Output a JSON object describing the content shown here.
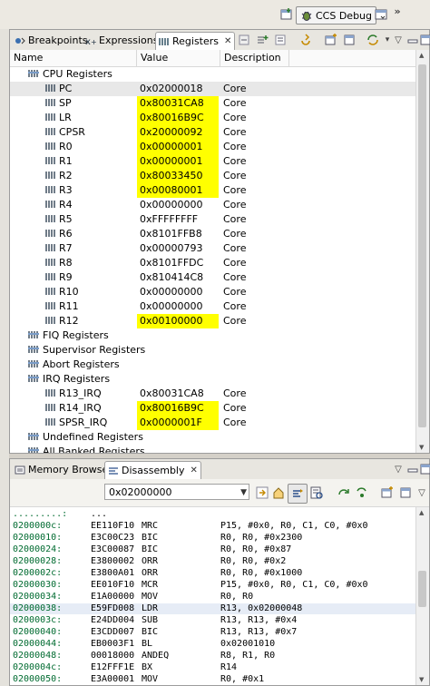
{
  "toolbar": {
    "perspective_label": "CCS Debug",
    "overflow_label": "»"
  },
  "registers_view": {
    "tabs": [
      {
        "label": "Breakpoints",
        "active": false
      },
      {
        "label": "Expressions",
        "active": false
      },
      {
        "label": "Registers",
        "active": true
      }
    ],
    "close_label": "✕",
    "columns": [
      "Name",
      "Value",
      "Description"
    ],
    "rows": [
      {
        "name": "CPU Registers",
        "value": "",
        "description": "",
        "group": true,
        "highlight": false
      },
      {
        "name": "PC",
        "value": "0x02000018",
        "description": "Core",
        "group": false,
        "highlight": false,
        "selected": true
      },
      {
        "name": "SP",
        "value": "0x80031CA8",
        "description": "Core",
        "group": false,
        "highlight": true
      },
      {
        "name": "LR",
        "value": "0x80016B9C",
        "description": "Core",
        "group": false,
        "highlight": true
      },
      {
        "name": "CPSR",
        "value": "0x20000092",
        "description": "Core",
        "group": false,
        "highlight": true
      },
      {
        "name": "R0",
        "value": "0x00000001",
        "description": "Core",
        "group": false,
        "highlight": true
      },
      {
        "name": "R1",
        "value": "0x00000001",
        "description": "Core",
        "group": false,
        "highlight": true
      },
      {
        "name": "R2",
        "value": "0x80033450",
        "description": "Core",
        "group": false,
        "highlight": true
      },
      {
        "name": "R3",
        "value": "0x00080001",
        "description": "Core",
        "group": false,
        "highlight": true
      },
      {
        "name": "R4",
        "value": "0x00000000",
        "description": "Core",
        "group": false,
        "highlight": false
      },
      {
        "name": "R5",
        "value": "0xFFFFFFFF",
        "description": "Core",
        "group": false,
        "highlight": false
      },
      {
        "name": "R6",
        "value": "0x8101FFB8",
        "description": "Core",
        "group": false,
        "highlight": false
      },
      {
        "name": "R7",
        "value": "0x00000793",
        "description": "Core",
        "group": false,
        "highlight": false
      },
      {
        "name": "R8",
        "value": "0x8101FFDC",
        "description": "Core",
        "group": false,
        "highlight": false
      },
      {
        "name": "R9",
        "value": "0x810414C8",
        "description": "Core",
        "group": false,
        "highlight": false
      },
      {
        "name": "R10",
        "value": "0x00000000",
        "description": "Core",
        "group": false,
        "highlight": false
      },
      {
        "name": "R11",
        "value": "0x00000000",
        "description": "Core",
        "group": false,
        "highlight": false
      },
      {
        "name": "R12",
        "value": "0x00100000",
        "description": "Core",
        "group": false,
        "highlight": true
      },
      {
        "name": "FIQ Registers",
        "value": "",
        "description": "",
        "group": true,
        "highlight": false
      },
      {
        "name": "Supervisor Registers",
        "value": "",
        "description": "",
        "group": true,
        "highlight": false
      },
      {
        "name": "Abort Registers",
        "value": "",
        "description": "",
        "group": true,
        "highlight": false
      },
      {
        "name": "IRQ Registers",
        "value": "",
        "description": "",
        "group": true,
        "highlight": false
      },
      {
        "name": "R13_IRQ",
        "value": "0x80031CA8",
        "description": "Core",
        "group": false,
        "highlight": false
      },
      {
        "name": "R14_IRQ",
        "value": "0x80016B9C",
        "description": "Core",
        "group": false,
        "highlight": true
      },
      {
        "name": "SPSR_IRQ",
        "value": "0x0000001F",
        "description": "Core",
        "group": false,
        "highlight": true
      },
      {
        "name": "Undefined Registers",
        "value": "",
        "description": "",
        "group": true,
        "highlight": false
      },
      {
        "name": "All Banked Registers",
        "value": "",
        "description": "",
        "group": true,
        "highlight": false
      }
    ]
  },
  "bottom_view": {
    "tabs": [
      {
        "label": "Memory Browser",
        "active": false
      },
      {
        "label": "Disassembly",
        "active": true
      }
    ],
    "close_label": "✕",
    "address_value": "0x02000000",
    "lines": [
      {
        "addr": ".........:",
        "op": "...",
        "mn": "",
        "args": ""
      },
      {
        "addr": "0200000c:",
        "op": "EE110F10",
        "mn": "MRC",
        "args": "P15, #0x0, R0, C1, C0, #0x0"
      },
      {
        "addr": "02000010:",
        "op": "E3C00C23",
        "mn": "BIC",
        "args": "R0, R0, #0x2300"
      },
      {
        "addr": "02000024:",
        "op": "E3C00087",
        "mn": "BIC",
        "args": "R0, R0, #0x87"
      },
      {
        "addr": "02000028:",
        "op": "E3800002",
        "mn": "ORR",
        "args": "R0, R0, #0x2"
      },
      {
        "addr": "0200002c:",
        "op": "E3800A01",
        "mn": "ORR",
        "args": "R0, R0, #0x1000"
      },
      {
        "addr": "02000030:",
        "op": "EE010F10",
        "mn": "MCR",
        "args": "P15, #0x0, R0, C1, C0, #0x0"
      },
      {
        "addr": "02000034:",
        "op": "E1A00000",
        "mn": "MOV",
        "args": "R0, R0"
      },
      {
        "addr": "02000038:",
        "op": "E59FD008",
        "mn": "LDR",
        "args": "R13, 0x02000048",
        "current": true
      },
      {
        "addr": "0200003c:",
        "op": "E24DD004",
        "mn": "SUB",
        "args": "R13, R13, #0x4"
      },
      {
        "addr": "02000040:",
        "op": "E3CDD007",
        "mn": "BIC",
        "args": "R13, R13, #0x7"
      },
      {
        "addr": "02000044:",
        "op": "EB0003F1",
        "mn": "BL",
        "args": "0x02001010"
      },
      {
        "addr": "02000048:",
        "op": "00018000",
        "mn": "ANDEQ",
        "args": "R8, R1, R0"
      },
      {
        "addr": "0200004c:",
        "op": "E12FFF1E",
        "mn": "BX",
        "args": "R14"
      },
      {
        "addr": "02000050:",
        "op": "E3A00001",
        "mn": "MOV",
        "args": "R0, #0x1"
      }
    ]
  },
  "colors": {
    "highlight": "#ffff00",
    "address_green": "#006b30",
    "current_line": "#e6ecf6"
  }
}
